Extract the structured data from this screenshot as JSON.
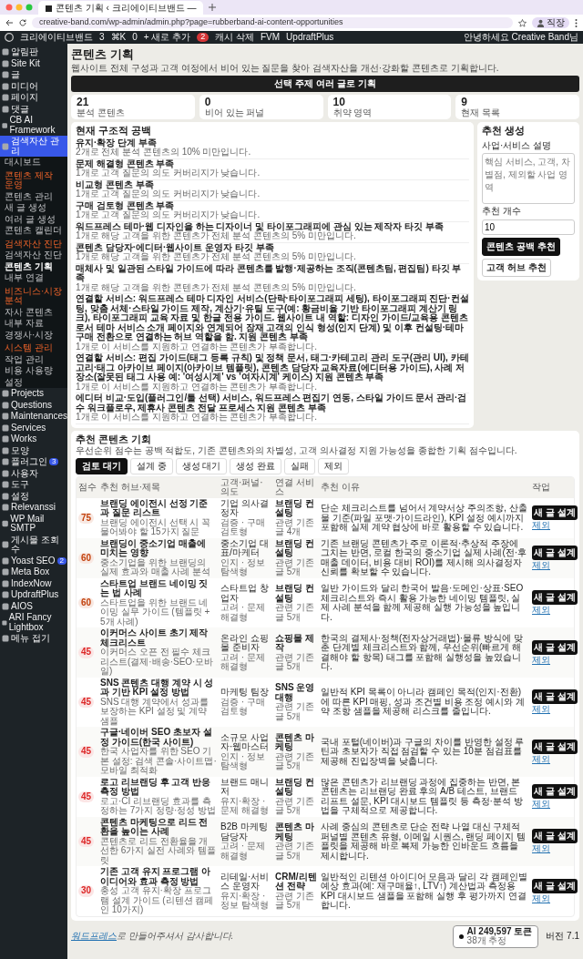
{
  "browser": {
    "tab_title": "콘텐츠 기획 ‹ 크리에이티브밴드 —",
    "address": "creative-band.com/wp-admin/admin.php?page=rubberband-ai-content-opportunities",
    "profile": "직장"
  },
  "admin_bar": {
    "site": "크리에이티브밴드",
    "updates": "3",
    "search": "⌘K",
    "comments": "0",
    "new": "+ 새로 추가",
    "yoast_badge": "2",
    "links": [
      "캐시 삭제",
      "FVM",
      "UpdraftPlus"
    ],
    "greeting": "안녕하세요 Creative Band님"
  },
  "sidebar": {
    "items": [
      {
        "kind": "item",
        "label": "알림판",
        "selected": false
      },
      {
        "kind": "item",
        "label": "Site Kit",
        "selected": false
      },
      {
        "kind": "item",
        "label": "글",
        "selected": false
      },
      {
        "kind": "item",
        "label": "미디어",
        "selected": false
      },
      {
        "kind": "item",
        "label": "페이지",
        "selected": false
      },
      {
        "kind": "item",
        "label": "댓글",
        "selected": false
      },
      {
        "kind": "item",
        "label": "CB AI Framework",
        "selected": false
      },
      {
        "kind": "item",
        "label": "검색자산 관리",
        "selected": true
      },
      {
        "kind": "sub",
        "label": "대시보드",
        "selected": false
      },
      {
        "kind": "heading",
        "label": "콘텐츠 제작 운영"
      },
      {
        "kind": "sub",
        "label": "콘텐츠 관리",
        "selected": false
      },
      {
        "kind": "sub",
        "label": "새 글 생성",
        "selected": false
      },
      {
        "kind": "sub",
        "label": "여러 글 생성",
        "selected": false
      },
      {
        "kind": "sub",
        "label": "콘텐츠 캘린더",
        "selected": false
      },
      {
        "kind": "heading",
        "label": "검색자산 진단"
      },
      {
        "kind": "sub",
        "label": "검색자산 진단",
        "selected": false
      },
      {
        "kind": "sub",
        "label": "콘텐츠 기획",
        "selected": true
      },
      {
        "kind": "sub",
        "label": "내부 연결",
        "selected": false
      },
      {
        "kind": "heading",
        "label": "비즈니스·시장 분석"
      },
      {
        "kind": "sub",
        "label": "자사 콘텐츠",
        "selected": false
      },
      {
        "kind": "sub",
        "label": "내부 자료",
        "selected": false
      },
      {
        "kind": "sub",
        "label": "경쟁사·시장",
        "selected": false
      },
      {
        "kind": "heading",
        "label": "시스템 관리"
      },
      {
        "kind": "sub",
        "label": "작업 관리",
        "selected": false
      },
      {
        "kind": "sub",
        "label": "비용 사용량",
        "selected": false
      },
      {
        "kind": "sub",
        "label": "설정",
        "selected": false
      },
      {
        "kind": "item",
        "label": "Projects",
        "selected": false
      },
      {
        "kind": "item",
        "label": "Questions",
        "selected": false
      },
      {
        "kind": "item",
        "label": "Maintenances",
        "selected": false
      },
      {
        "kind": "item",
        "label": "Services",
        "selected": false
      },
      {
        "kind": "item",
        "label": "Works",
        "selected": false
      },
      {
        "kind": "item",
        "label": "모양",
        "selected": false
      },
      {
        "kind": "item",
        "label": "플러그인",
        "selected": false,
        "badge": "3"
      },
      {
        "kind": "item",
        "label": "사용자",
        "selected": false
      },
      {
        "kind": "item",
        "label": "도구",
        "selected": false
      },
      {
        "kind": "item",
        "label": "설정",
        "selected": false
      },
      {
        "kind": "item",
        "label": "Relevanssi",
        "selected": false
      },
      {
        "kind": "item",
        "label": "WP Mail SMTP",
        "selected": false
      },
      {
        "kind": "item",
        "label": "게시물 조회수",
        "selected": false
      },
      {
        "kind": "item",
        "label": "Yoast SEO",
        "selected": false,
        "badge": "2"
      },
      {
        "kind": "item",
        "label": "Meta Box",
        "selected": false
      },
      {
        "kind": "item",
        "label": "IndexNow",
        "selected": false
      },
      {
        "kind": "item",
        "label": "UpdraftPlus",
        "selected": false
      },
      {
        "kind": "item",
        "label": "AIOS",
        "selected": false
      },
      {
        "kind": "item",
        "label": "ARI Fancy Lightbox",
        "selected": false
      },
      {
        "kind": "item",
        "label": "메뉴 접기",
        "selected": false
      }
    ]
  },
  "page": {
    "title": "콘텐츠 기획",
    "description": "웹사이트 전체 구성과 고객 여정에서 비어 있는 질문을 찾아 검색자산을 개선·강화할 콘텐츠로 기획합니다.",
    "plan_button": "선택 주제 여러 글로 기획"
  },
  "stats": [
    {
      "value": "21",
      "label": "분석 콘텐츠"
    },
    {
      "value": "0",
      "label": "비어 있는 퍼널"
    },
    {
      "value": "10",
      "label": "취약 영역"
    },
    {
      "value": "9",
      "label": "현재 목록"
    }
  ],
  "gaps": {
    "title": "현재 구조적 공백",
    "items": [
      {
        "title": "유지·확장 단계 부족",
        "desc": "2개로 전체 분석 콘텐츠의 10% 미만입니다."
      },
      {
        "title": "문제 해결형 콘텐츠 부족",
        "desc": "1개로 고객 질문의 의도 커버리지가 낮습니다."
      },
      {
        "title": "비교형 콘텐츠 부족",
        "desc": "1개로 고객 질문의 의도 커버리지가 낮습니다."
      },
      {
        "title": "구매 검토형 콘텐츠 부족",
        "desc": "1개로 고객 질문의 의도 커버리지가 낮습니다."
      },
      {
        "title": "워드프레스 테마·웹 디자인을 하는 디자이너 및 타이포그래피에 관심 있는 제작자 타깃 부족",
        "desc": "1개로 해당 고객을 위한 콘텐츠가 전체 분석 콘텐츠의 5% 미만입니다."
      },
      {
        "title": "콘텐츠 담당자·에디터·웹사이트 운영자 타깃 부족",
        "desc": "1개로 해당 고객을 위한 콘텐츠가 전체 분석 콘텐츠의 5% 미만입니다."
      },
      {
        "title": "매체사 및 일관된 스타일 가이드에 따라 콘텐츠를 발행·제공하는 조직(콘텐츠팀, 편집팀) 타깃 부족",
        "desc": "1개로 해당 고객을 위한 콘텐츠가 전체 분석 콘텐츠의 5% 미만입니다."
      },
      {
        "title": "연결할 서비스: 워드프레스 테마 디자인 서비스(단락·타이포그래피 세팅), 타이포그래피 진단·컨설팅, 맞춤 서체·스타일 가이드 제작, 계산기·유틸 도구(예: 황금비율 기반 타이포그래피 계산기 링크), 타이포그래피 교육 자료 및 한글 전용 가이드. 웹사이트 내 역할: 디자인 가이드/교육용 콘텐츠로서 테마 서비스 소개 페이지와 연계되어 잠재 고객의 인식 형성(인지 단계) 및 이후 컨설팅·테마 구매 전환으로 연결하는 허브 역할을 함. 지원 콘텐츠 부족",
        "desc": "1개로 이 서비스를 지원하고 연결하는 콘텐츠가 부족합니다."
      },
      {
        "title": "연결할 서비스: 편집 가이드(태그 등록 규칙) 및 정책 문서, 태그·카테고리 관리 도구(관리 UI), 카테고리·태그 아카이브 페이지(아카이브 템플릿), 콘텐츠 담당자 교육자료(에디터용 가이드), 사례 저장소(잘못된 태그 사용 예: '여성시계' vs '여자시계' 케이스) 지원 콘텐츠 부족",
        "desc": "1개로 이 서비스를 지원하고 연결하는 콘텐츠가 부족합니다."
      },
      {
        "title": "에디터 비교·도입(플러그인/툴 선택) 서비스, 워드프레스 편집기 연동, 스타일 가이드 문서 관리·검수 워크플로우, 제휴사 콘텐츠 전달 프로세스 지원 콘텐츠 부족",
        "desc": "1개로 이 서비스를 지원하고 연결하는 콘텐츠가 부족합니다."
      }
    ]
  },
  "generator": {
    "title": "추천 생성",
    "description_label": "사업·서비스 설명",
    "description_placeholder": "핵심 서비스, 고객, 차별점, 제외할 사업 영역",
    "count_label": "추천 개수",
    "count_value": "10",
    "buttons": [
      {
        "label": "콘텐츠 공백 추천",
        "kind": "primary"
      },
      {
        "label": "고객 허브 추천",
        "kind": "secondary"
      }
    ]
  },
  "recommendations": {
    "title": "추천 콘텐츠 기회",
    "description": "우선순위 점수는 공백 적합도, 기존 콘텐츠와의 차별성, 고객 의사결정 지원 가능성을 종합한 기획 점수입니다.",
    "filters": [
      {
        "label": "검토 대기",
        "selected": true
      },
      {
        "label": "설계 중",
        "selected": false
      },
      {
        "label": "생성 대기",
        "selected": false
      },
      {
        "label": "생성 완료",
        "selected": false
      },
      {
        "label": "실패",
        "selected": false
      },
      {
        "label": "제외",
        "selected": false
      }
    ],
    "columns": [
      "점수",
      "추천 허브·제목",
      "고객·퍼널·의도",
      "연결 서비스",
      "추천 이유",
      "작업"
    ],
    "rows": [
      {
        "score": "75",
        "color": "#c2410c",
        "title": "브랜딩 에이전시 선정 기준과 질문 리스트",
        "subtitle": "브랜딩 에이전시 선택 시 꼭 물어봐야 할 15가지 질문",
        "customer": "기업 의사결정자",
        "funnel": "검증 · 구매 검토형",
        "service": "브랜딩 컨설팅",
        "related": "관련 기존 글 4개",
        "reason": "단순 체크리스트를 넘어서 계약서상 주의조항, 산출물 기준(파일 포맷·가이드라인), KPI 설정 예시까지 포함해 실제 계약 협상에 바로 활용할 수 있습니다.",
        "action": "새 글 설계",
        "exclude": "제외"
      },
      {
        "score": "60",
        "color": "#c2410c",
        "title": "브랜딩이 중소기업 매출에 미치는 영향",
        "subtitle": "중소기업을 위한 브랜딩의 실제 효과와 매출 사례 분석",
        "customer": "중소기업 대표/마케터",
        "funnel": "인지 · 정보 탐색형",
        "service": "브랜딩 컨설팅",
        "related": "관련 기존 글 5개",
        "reason": "기존 브랜딩 콘텐츠가 주로 이론적·추상적 주장에 그치는 반면, 로컬 한국의 중소기업 실제 사례(전·후 매출 데이터, 비용 대비 ROI)를 제시해 의사결정자 신뢰를 확보할 수 있습니다.",
        "action": "새 글 설계",
        "exclude": "제외"
      },
      {
        "score": "60",
        "color": "#c2410c",
        "title": "스타트업 브랜드 네이밍 짓는 법 사례",
        "subtitle": "스타트업을 위한 브랜드 네이밍 실무 가이드 (템플릿 + 5개 사례)",
        "customer": "스타트업 창업자",
        "funnel": "고려 · 문제 해결형",
        "service": "브랜딩 컨설팅",
        "related": "관련 기존 글 5개",
        "reason": "일반 가이드와 달리 한국어 발음·도메인·상표·SEO 체크리스트와 즉시 활용 가능한 네이밍 템플릿, 실제 사례 분석을 함께 제공해 실행 가능성을 높입니다.",
        "action": "새 글 설계",
        "exclude": "제외"
      },
      {
        "score": "45",
        "color": "#dc2626",
        "title": "이커머스 사이트 초기 제작 체크리스트",
        "subtitle": "이커머스 오픈 전 필수 체크리스트(결제·배송·SEO·모바일)",
        "customer": "온라인 쇼핑몰 준비자",
        "funnel": "고려 · 문제 해결형",
        "service": "쇼핑몰 제작",
        "related": "관련 기존 글 5개",
        "reason": "한국의 결제사·정책(전자상거래법)·물류 방식에 맞춘 단계별 체크리스트와 함께, 우선순위(빠르게 해결해야 할 항목) 태그를 포함해 실행성을 높였습니다.",
        "action": "새 글 설계",
        "exclude": "제외"
      },
      {
        "score": "45",
        "color": "#dc2626",
        "title": "SNS 콘텐츠 대행 계약 시 성과 기반 KPI 설정 방법",
        "subtitle": "SNS 대행 계약에서 성과를 보장하는 KPI 설정 및 계약 샘플",
        "customer": "마케팅 팀장",
        "funnel": "검증 · 구매 검토형",
        "service": "SNS 운영대행",
        "related": "관련 기존 글 5개",
        "reason": "일반적 KPI 목록이 아니라 캠페인 목적(인지·전환)에 따른 KPI 매핑, 성과 조건별 비용 조정 예시와 계약 조항 샘플을 제공해 리스크를 줄입니다.",
        "action": "새 글 설계",
        "exclude": "제외"
      },
      {
        "score": "45",
        "color": "#dc2626",
        "title": "구글·네이버 SEO 초보자 설정 가이드(한국 사이트)",
        "subtitle": "한국 사업자를 위한 SEO 기본 설정: 검색 콘솔·사이트맵·모바일 최적화",
        "customer": "소규모 사업자·웹마스터",
        "funnel": "인지 · 정보 탐색형",
        "service": "콘텐츠 마케팅",
        "related": "관련 기존 글 5개",
        "reason": "국내 포털(네이버)과 구글의 차이를 반영한 설정 루틴과 초보자가 직접 점검할 수 있는 10분 점검표를 제공해 진입장벽을 낮춥니다.",
        "action": "새 글 설계",
        "exclude": "제외"
      },
      {
        "score": "45",
        "color": "#dc2626",
        "title": "로고 리브랜딩 후 고객 반응 측정 방법",
        "subtitle": "로고·CI 리브랜딩 효과를 측정하는 7가지 정량·정성 방법",
        "customer": "브랜드 매니저",
        "funnel": "유지·확장 · 문제 해결형",
        "service": "브랜딩 컨설팅",
        "related": "관련 기존 글 5개",
        "reason": "많은 콘텐츠가 리브랜딩 과정에 집중하는 반면, 본 콘텐츠는 리브랜딩 완료 후의 A/B 테스트, 브랜드 리프트 설문, KPI 대시보드 템플릿 등 측정·분석 방법을 구체적으로 제공합니다.",
        "action": "새 글 설계",
        "exclude": "제외"
      },
      {
        "score": "45",
        "color": "#dc2626",
        "title": "콘텐츠 마케팅으로 리드 전환을 높이는 사례",
        "subtitle": "콘텐츠로 리드 전환율을 개선한 6가지 실전 사례와 템플릿",
        "customer": "B2B 마케팅 담당자",
        "funnel": "고려 · 문제 해결형",
        "service": "콘텐츠 마케팅",
        "related": "관련 기존 글 5개",
        "reason": "사례 중심의 콘텐츠로 단순 전략 나열 대신 구체적 퍼널별 콘텐츠 유형, 이메일 시퀀스, 랜딩 페이지 템플릿을 제공해 바로 복제 가능한 인바운드 흐름을 제시합니다.",
        "action": "새 글 설계",
        "exclude": "제외"
      },
      {
        "score": "30",
        "color": "#dc2626",
        "title": "기존 고객 유지 프로그램 아이디어와 효과 측정 방법",
        "subtitle": "충성 고객 유지·확장 프로그램 설계 가이드 (리텐션 캠페인 10가지)",
        "customer": "리테일·서비스 운영자",
        "funnel": "유지·확장 · 정보 탐색형",
        "service": "CRM/리텐션 전략",
        "related": "관련 기존 글 5개",
        "reason": "일반적인 리텐션 아이디어 모음과 달리 각 캠페인별 예상 효과(예: 재구매율↑, LTV↑) 계산법과 측정용 KPI 대시보드 샘플을 포함해 실행 후 평가까지 연결합니다.",
        "action": "새 글 설계",
        "exclude": "제외"
      }
    ]
  },
  "token_widget": {
    "label": "AI 249,597 토큰",
    "sub": "38개 추정"
  },
  "footer": {
    "link": "워드프레스",
    "text": "로 만들어주셔서 감사합니다.",
    "version": "버전 7.1"
  }
}
